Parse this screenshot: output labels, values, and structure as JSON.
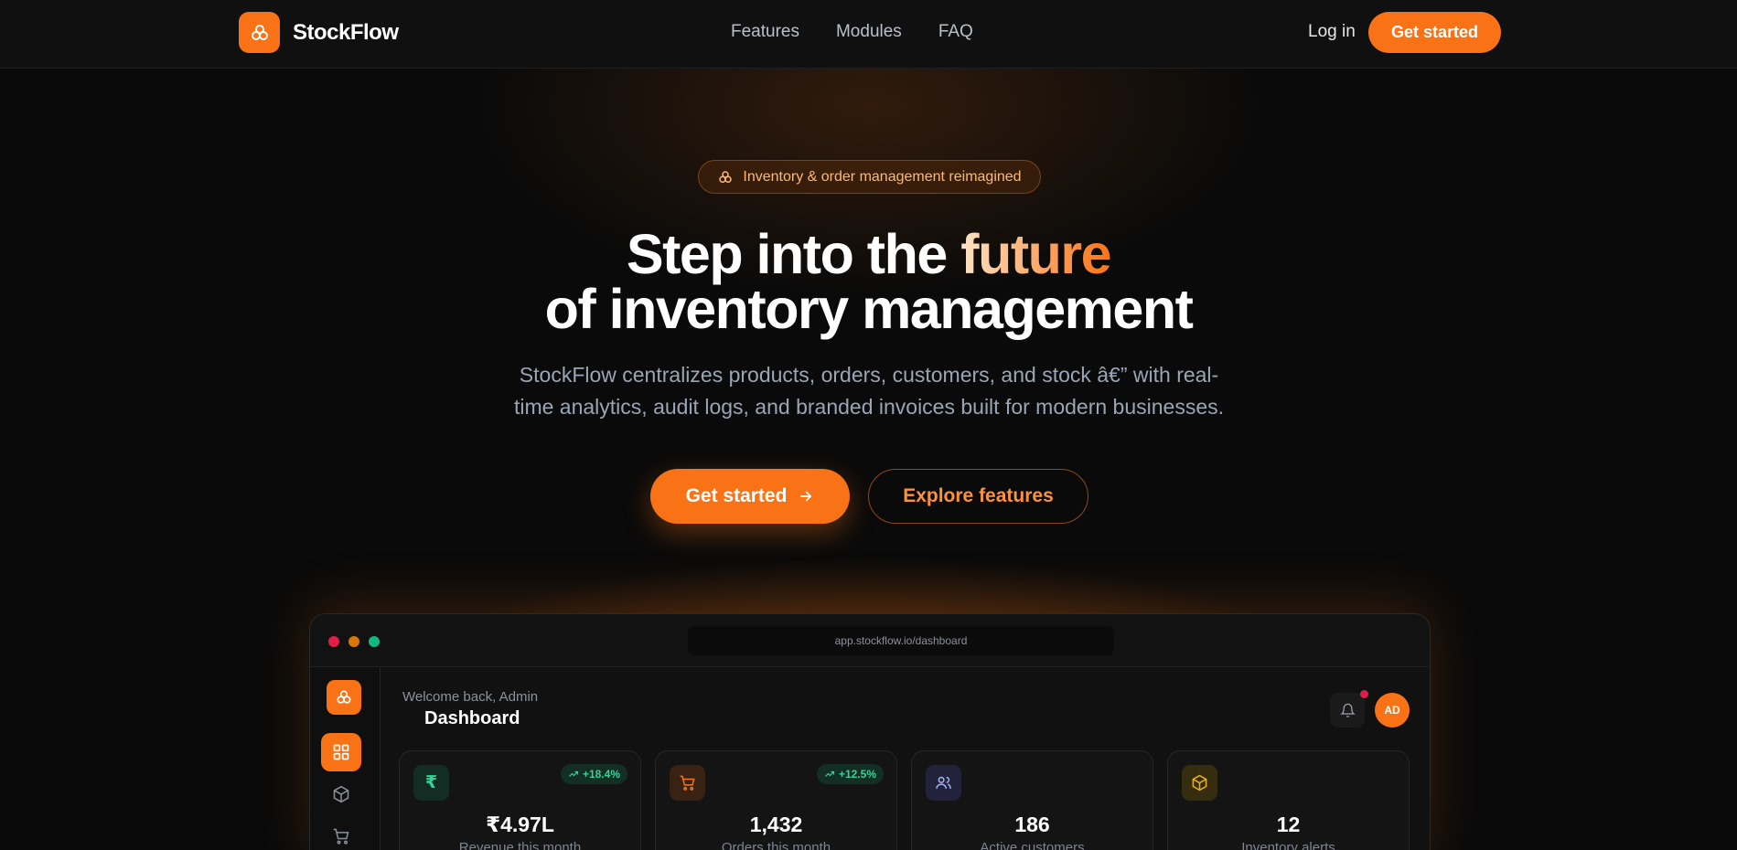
{
  "header": {
    "brand_name": "StockFlow",
    "nav": [
      {
        "label": "Features"
      },
      {
        "label": "Modules"
      },
      {
        "label": "FAQ"
      }
    ],
    "login_label": "Log in",
    "cta_label": "Get started"
  },
  "hero": {
    "badge_text": "Inventory & order management reimagined",
    "headline_part1": "Step into the ",
    "headline_accent": "future",
    "headline_line2": "of inventory management",
    "subtitle_line1": "StockFlow centralizes products, orders, customers, and stock â€” with real-",
    "subtitle_line2": "time analytics, audit logs, and branded invoices built for modern businesses.",
    "primary_cta": "Get started",
    "secondary_cta": "Explore features"
  },
  "preview": {
    "url": "app.stockflow.io/dashboard",
    "welcome": "Welcome back, Admin",
    "title": "Dashboard",
    "avatar_initials": "AD",
    "cards": [
      {
        "icon": "rupee-icon",
        "delta": "+18.4%",
        "value": "₹4.97L",
        "label": "Revenue this month"
      },
      {
        "icon": "cart-icon",
        "delta": "+12.5%",
        "value": "1,432",
        "label": "Orders this month"
      },
      {
        "icon": "users-icon",
        "delta": "",
        "value": "186",
        "label": "Active customers"
      },
      {
        "icon": "box-icon",
        "delta": "",
        "value": "12",
        "label": "Inventory alerts"
      }
    ]
  },
  "colors": {
    "accent": "#f97316",
    "background": "#0a0a0a",
    "positive": "#34d399",
    "alert_dot": "#e11d48"
  }
}
